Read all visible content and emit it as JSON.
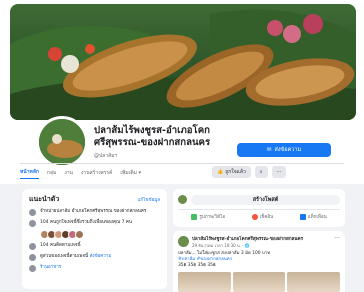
{
  "page": {
    "title": "ปลาส้มไร้พงชูรส-อำเภอโคก ศรีสุพรรณ-ของฝากสกลนคร",
    "handle": "@ปลาส้มฯ",
    "message_button": "ส่งข้อความ"
  },
  "tabs": [
    "หน้าหลัก",
    "กลุ่ม",
    "งาน",
    "งานสร้างสรรค์",
    "เพิ่มเติม ▾"
  ],
  "actions": {
    "like": "ถูกใจแล้ว",
    "search": "⌕",
    "more": "···"
  },
  "intro": {
    "title": "แนะนำตัว",
    "edit_link": "แก้ไขข้อมูล",
    "rows": [
      "จำหน่ายปลาส้ม อำเภอโคกศรีสุพรรณ ของฝากสกลนคร",
      "104 คนถูกใจเพจนี้ซึ่งรวมถึงเพื่อนของคุณ 7 คน",
      "104 คนติดตามเพจนี้",
      "ดูส่วนของเพจนี้ตามเพจนี้"
    ],
    "link_text": "ส่งข้อความ",
    "category": "ร้านอาหาร"
  },
  "create_post": {
    "prompt": "สร้างโพสต์",
    "options": [
      "รูปภาพ/วิดีโอ",
      "เช็คอิน",
      "แท็กเพื่อน"
    ]
  },
  "post": {
    "author": "ปลาส้มไร้พงชูรส-อำเภอโคกศรีสุพรรณ-ของฝากสกลนคร",
    "time": "29 ธันวาคม เวลา 10:30 น. · 🌐",
    "text": "ปลาส้ม... ไม่ใส่ผงชูรส ส่งปลาส้ม 3 มัด 100 บาท",
    "tags": "#ปลาส้ม #ของฝากสกลนคร",
    "prices": "35฿ 35฿ 35฿ 35฿"
  },
  "colors": {
    "accent": "#1877f2",
    "background": "#f0f2f5"
  }
}
